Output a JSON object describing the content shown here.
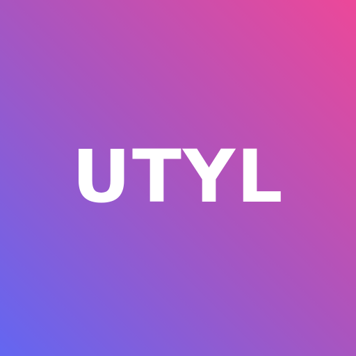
{
  "logo": {
    "text": "UTYL",
    "text_color": "#ffffff",
    "gradient_colors": [
      "#6366f1",
      "#a855c0",
      "#ec4899"
    ]
  }
}
